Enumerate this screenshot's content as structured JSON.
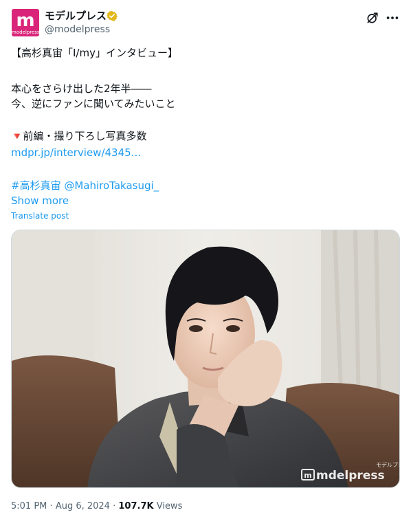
{
  "header": {
    "avatar_mark": "m",
    "avatar_sub": "modelpress",
    "display_name": "モデルプレス",
    "handle": "@modelpress"
  },
  "tweet": {
    "line1": "【高杉真宙「I/my」インタビュー】",
    "line2": "本心をさらけ出した2年半――",
    "line3": "今、逆にファンに聞いてみたいこと",
    "line4_emoji": "🔻",
    "line4_text": "前編・撮り下ろし写真多数",
    "link": "mdpr.jp/interview/4345...",
    "hashtag": "#高杉真宙",
    "mention": "@MahiroTakasugi_",
    "show_more": "Show more",
    "translate": "Translate post"
  },
  "media": {
    "watermark_brand": "mdelpress",
    "watermark_small": "モデルプレス"
  },
  "meta": {
    "time": "5:01 PM",
    "sep1": "·",
    "date": "Aug 6, 2024",
    "sep2": "·",
    "views_count": "107.7K",
    "views_label": "Views"
  },
  "colors": {
    "link": "#1d9bf0",
    "brand": "#d9267a",
    "badge": "#e2b719",
    "text": "#0f1419",
    "secondary": "#536471"
  }
}
